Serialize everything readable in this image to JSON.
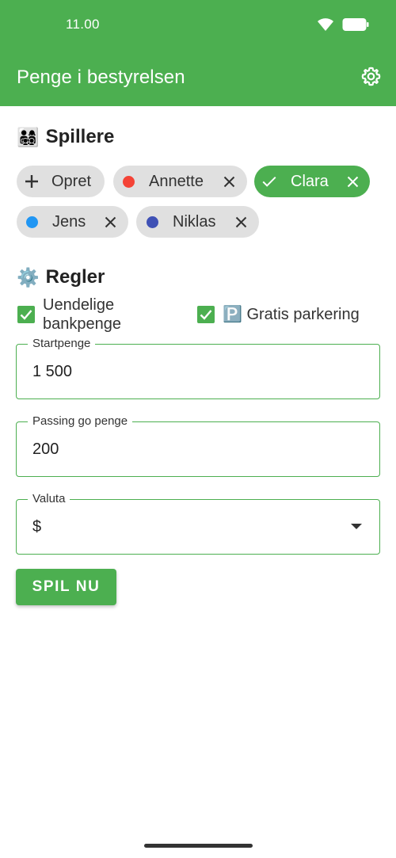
{
  "status_bar": {
    "time": "11.00",
    "icons": [
      "wifi-icon",
      "battery-icon"
    ]
  },
  "app_bar": {
    "title": "Penge i bestyrelsen",
    "settings_icon": "gear-icon",
    "color": "#4caf50"
  },
  "players_section": {
    "emoji": "👨‍👩‍👧‍👦",
    "heading": "Spillere",
    "add_chip": {
      "label": "Opret",
      "icon": "plus-icon"
    },
    "chips": [
      {
        "name": "Annette",
        "color": "#f44336",
        "selected": false
      },
      {
        "name": "Clara",
        "color": "#4caf50",
        "selected": true
      },
      {
        "name": "Jens",
        "color": "#2196f3",
        "selected": false
      },
      {
        "name": "Niklas",
        "color": "#3f51b5",
        "selected": false
      }
    ]
  },
  "rules_section": {
    "emoji": "⚙️",
    "heading": "Regler",
    "checkboxes": [
      {
        "label_line1": "Uendelige",
        "label_line2": "bankpenge",
        "checked": true
      },
      {
        "label": "🅿️ Gratis parkering",
        "checked": true
      }
    ],
    "fields": {
      "start_money": {
        "label": "Startpenge",
        "value": "1 500"
      },
      "passing_go": {
        "label": "Passing go penge",
        "value": "200"
      },
      "currency": {
        "label": "Valuta",
        "value": "$"
      }
    }
  },
  "play_button": {
    "label": "SPIL NU"
  }
}
